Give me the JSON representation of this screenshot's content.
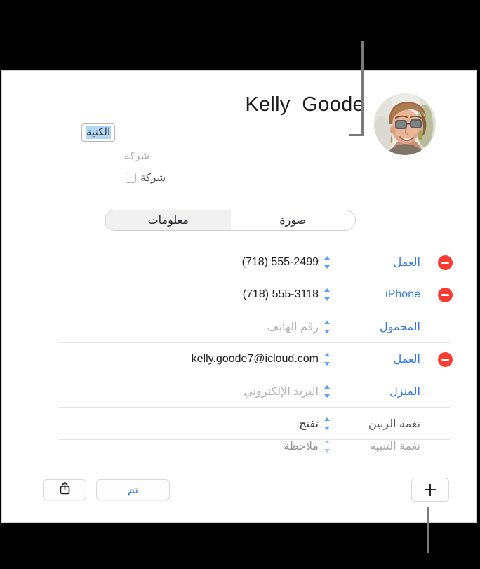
{
  "annotation": {
    "callout_top": "leader-line-to-lastname-field",
    "callout_bottom": "leader-line-to-add-button"
  },
  "header": {
    "contact_name": "Kelly  Goode",
    "lastname_field_value": "الكنية",
    "company_placeholder": "شركة",
    "company_checkbox_label": "شركة",
    "avatar_name": "contact-avatar-photo"
  },
  "tabs": [
    {
      "label": "صورة",
      "selected": false,
      "shaded": false
    },
    {
      "label": "معلومات",
      "selected": true,
      "shaded": true
    }
  ],
  "fields": [
    {
      "label": "العمل",
      "value": "(718) 555-2499",
      "value_style": "ltr",
      "removable": true,
      "divider": false,
      "stepper": "updown"
    },
    {
      "label": "iPhone",
      "value": "(718) 555-3118",
      "value_style": "ltr",
      "removable": true,
      "divider": false,
      "stepper": "updown"
    },
    {
      "label": "المحمول",
      "value": "رقم الهاتف",
      "value_style": "placeholder",
      "removable": false,
      "divider": true,
      "stepper": "updown"
    },
    {
      "label": "العمل",
      "value": "kelly.goode7@icloud.com",
      "value_style": "ltr",
      "removable": true,
      "divider": false,
      "stepper": "updown"
    },
    {
      "label": "المنزل",
      "value": "البريد الإلكتروني",
      "value_style": "placeholder",
      "removable": false,
      "divider": true,
      "stepper": "updown"
    },
    {
      "label": "نغمة الرنين",
      "value": "تفتح",
      "value_style": "rtl",
      "removable": false,
      "divider": true,
      "stepper": "updown",
      "label_style": "plain"
    }
  ],
  "clipped_field": {
    "label": "نغمة التنبيه",
    "value": "ملاحظة",
    "value_style": "rtl",
    "label_style": "plain"
  },
  "toolbar": {
    "share_label": "مشاركة",
    "share_icon": "share-icon",
    "done_label": "تم",
    "add_label": "إضافة",
    "add_icon": "plus-icon"
  },
  "colors": {
    "accent_blue": "#2f78e8",
    "remove_red": "#fb3b30",
    "selection_blue": "#b3d7f7",
    "callout_gray": "#7a7a7a",
    "backdrop": "#000000",
    "card_bg": "#ffffff"
  }
}
